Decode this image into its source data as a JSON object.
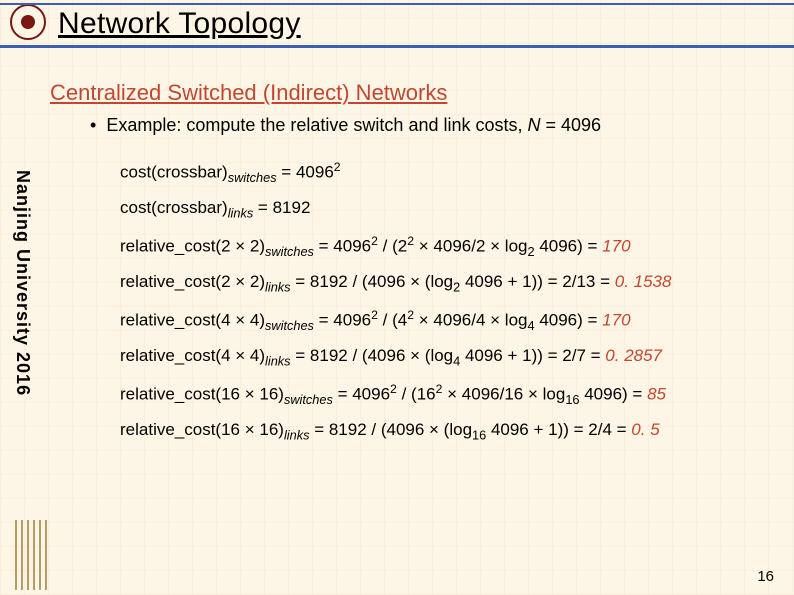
{
  "title": "Network Topology",
  "subtitle": "Centralized Switched (Indirect) Networks",
  "bullet": "Example: compute the relative switch and link costs, ",
  "bullet_n_label": "N",
  "bullet_n_value": " = 4096",
  "sidebar": "Nanjing University 2016",
  "lines": {
    "l1a": "cost(crossbar)",
    "l1b": "switches",
    "l1c": " = 4096",
    "l1d": "2",
    "l2a": "cost(crossbar)",
    "l2b": "links",
    "l2c": " = 8192",
    "l3a": "relative_cost(2 × 2)",
    "l3b": "switches",
    "l3c": " = 4096",
    "l3d": "2",
    "l3e": " / (2",
    "l3f": "2",
    "l3g": " × 4096/2 × log",
    "l3h": "2",
    "l3i": " 4096) = ",
    "l3r": "170",
    "l4a": "relative_cost(2 × 2)",
    "l4b": "links",
    "l4c": " = 8192 / (4096 × (log",
    "l4d": "2",
    "l4e": " 4096 + 1)) = 2/13 = ",
    "l4r": "0. 1538",
    "l5a": "relative_cost(4 × 4)",
    "l5b": "switches",
    "l5c": " = 4096",
    "l5d": "2",
    "l5e": " / (4",
    "l5f": "2",
    "l5g": " × 4096/4 × log",
    "l5h": "4",
    "l5i": " 4096) = ",
    "l5r": "170",
    "l6a": "relative_cost(4 × 4)",
    "l6b": "links",
    "l6c": " = 8192 / (4096 × (log",
    "l6d": "4",
    "l6e": " 4096 + 1)) = 2/7 = ",
    "l6r": "0. 2857",
    "l7a": "relative_cost(16 × 16)",
    "l7b": "switches",
    "l7c": " = 4096",
    "l7d": "2",
    "l7e": " / (16",
    "l7f": "2",
    "l7g": " × 4096/16 × log",
    "l7h": "16",
    "l7i": " 4096) = ",
    "l7r": "85",
    "l8a": "relative_cost(16 × 16)",
    "l8b": "links",
    "l8c": " = 8192 / (4096 × (log",
    "l8d": "16",
    "l8e": " 4096 + 1)) = 2/4 = ",
    "l8r": "0. 5"
  },
  "pagenum": "16"
}
